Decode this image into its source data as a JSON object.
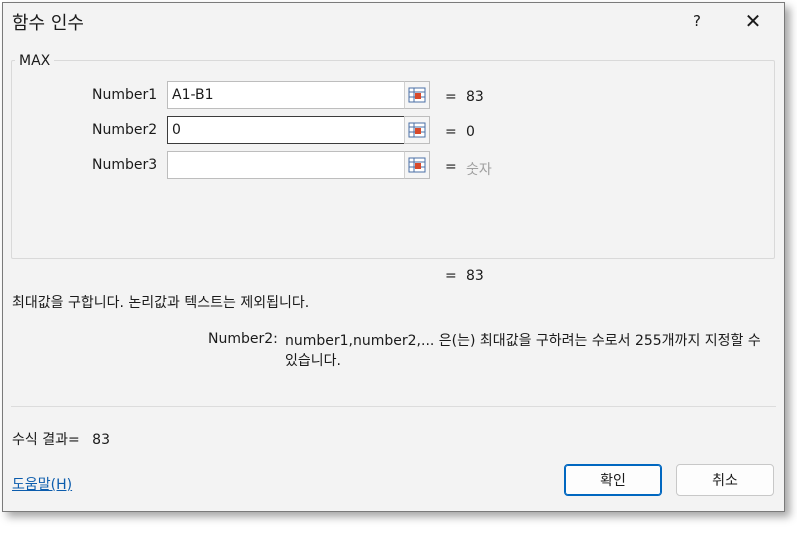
{
  "window": {
    "title": "함수 인수",
    "help_label": "?",
    "close_label": "✕"
  },
  "function": {
    "name": "MAX",
    "args": [
      {
        "label": "Number1",
        "value": "A1-B1",
        "result": "83"
      },
      {
        "label": "Number2",
        "value": "0",
        "result": "0"
      },
      {
        "label": "Number3",
        "value": "",
        "result": "숫자"
      }
    ],
    "equals": "=",
    "overall_result": "83",
    "description": "최대값을 구합니다. 논리값과 텍스트는 제외됩니다.",
    "arg_help_label": "Number2:",
    "arg_help_text": "number1,number2,... 은(는) 최대값을 구하려는 수로서 255개까지 지정할 수 있습니다."
  },
  "footer": {
    "formula_result_label": "수식 결과=",
    "formula_result_value": "83",
    "help_link": "도움말(H)",
    "ok_label": "확인",
    "cancel_label": "취소"
  },
  "icons": {
    "ref_button": "range-select-icon",
    "close": "close-icon"
  },
  "colors": {
    "link": "#0b5cad",
    "primary_border": "#0067c0",
    "placeholder": "#a0a0a0"
  }
}
